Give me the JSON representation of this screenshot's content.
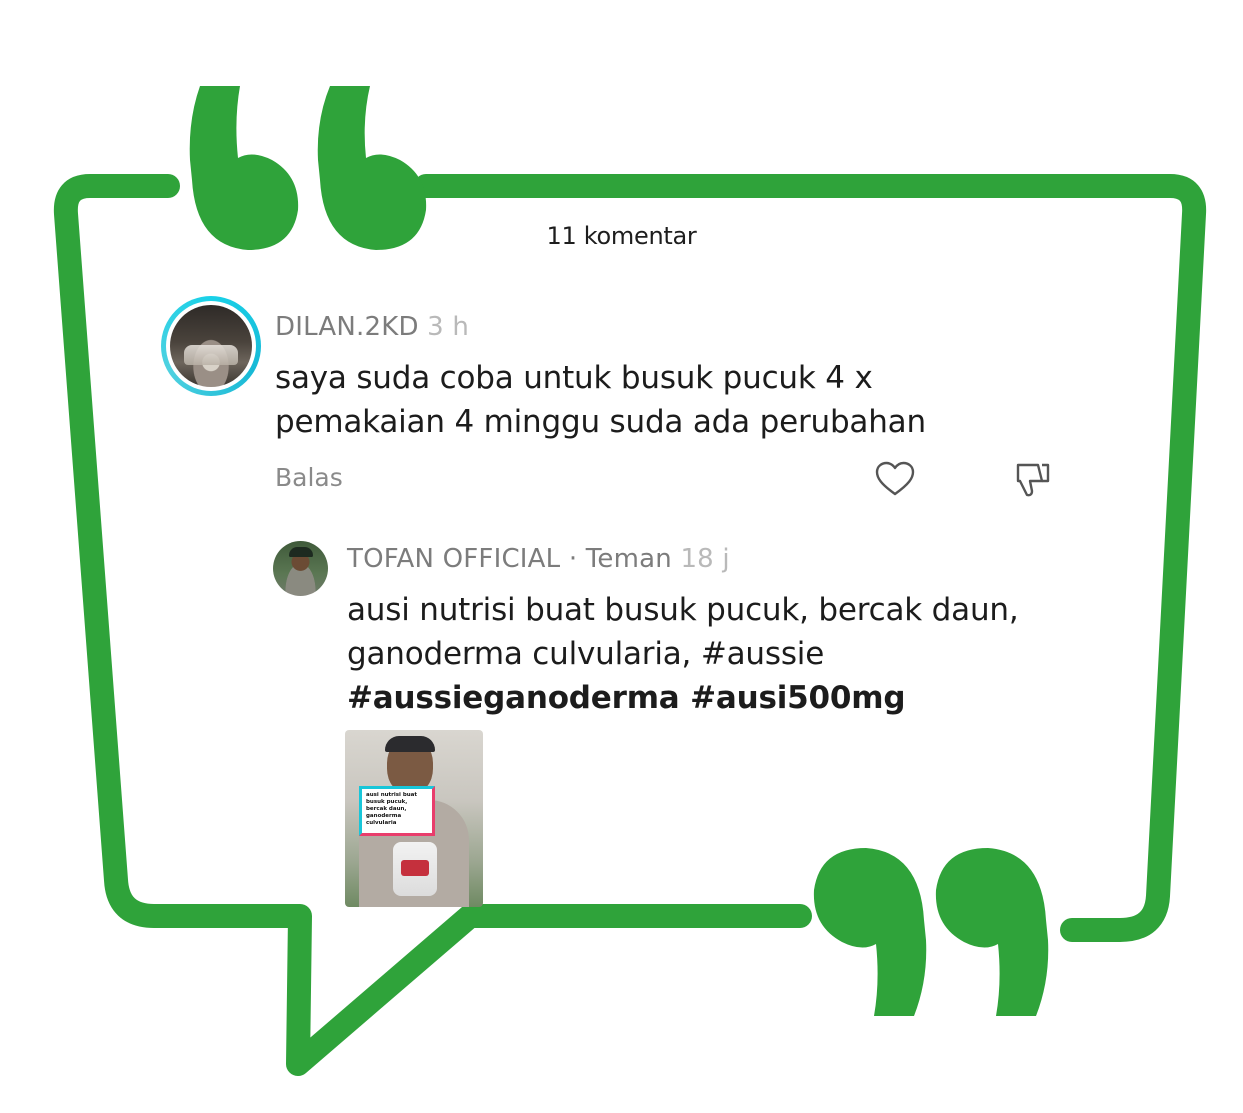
{
  "colors": {
    "frame_green": "#2fa33a",
    "avatar_ring": "#19d1e8"
  },
  "header": {
    "comment_count": "11 komentar"
  },
  "comments": [
    {
      "username": "DILAN.2KD",
      "time": "3 h",
      "text_line1": "saya suda coba untuk busuk pucuk 4 x",
      "text_line2": "pemakaian 4 minggu suda ada perubahan",
      "reply_label": "Balas",
      "like_icon": "heart-outline-icon",
      "dislike_icon": "thumbs-down-outline-icon"
    }
  ],
  "reply": {
    "username": "TOFAN OFFICIAL",
    "relation": "· Teman",
    "time": "18 j",
    "text_line1": "ausi nutrisi buat busuk pucuk, bercak daun,",
    "text_line2": "ganoderma culvularia, #aussie",
    "text_line3": "#aussieganoderma #ausi500mg",
    "thumbnail_caption_lines": [
      "ausi nutrisi buat",
      "busuk pucuk,",
      "bercak daun,",
      "ganoderma",
      "culvularia"
    ]
  }
}
